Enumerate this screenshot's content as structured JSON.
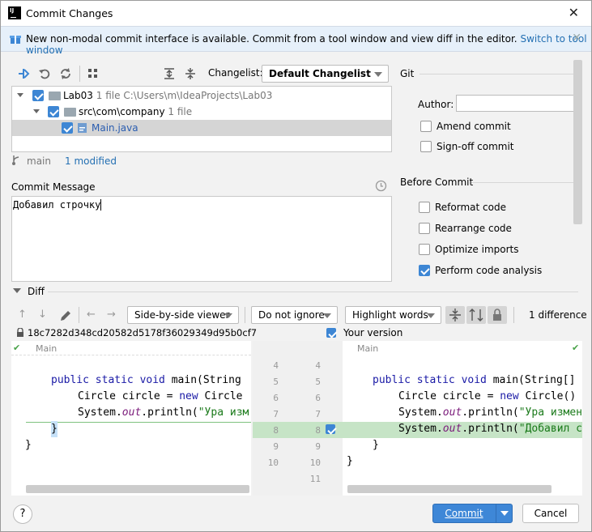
{
  "window": {
    "title": "Commit Changes",
    "close": "✕"
  },
  "banner": {
    "text": "New non-modal commit interface is available. Commit from a tool window and view diff in the editor.",
    "link": "Switch to tool window",
    "close": "✕"
  },
  "toolbar": {
    "changelist_label": "Changelist:",
    "changelist_value": "Default Changelist"
  },
  "tree": {
    "root": {
      "name": "Lab03",
      "info": "1 file",
      "path": "C:\\Users\\m\\IdeaProjects\\Lab03"
    },
    "pkg": {
      "name": "src\\com\\company",
      "info": "1 file"
    },
    "file": {
      "name": "Main.java"
    }
  },
  "status": {
    "branch": "main",
    "modified": "1 modified"
  },
  "commit_message": {
    "label": "Commit Message",
    "text": "Добавил строчку"
  },
  "git": {
    "title": "Git",
    "author_label": "Author:",
    "author_value": "",
    "amend": "Amend commit",
    "signoff": "Sign-off commit"
  },
  "before_commit": {
    "title": "Before Commit",
    "options": [
      {
        "label": "Reformat code",
        "checked": false
      },
      {
        "label": "Rearrange code",
        "checked": false
      },
      {
        "label": "Optimize imports",
        "checked": false
      },
      {
        "label": "Perform code analysis",
        "checked": true
      }
    ]
  },
  "diff": {
    "title": "Diff",
    "viewer": "Side-by-side viewer",
    "ignore": "Do not ignore",
    "highlight": "Highlight words",
    "count": "1 difference",
    "left_hash": "18c7282d348cd20582d5178f36029349d95b0cf7",
    "right_label": "Your version",
    "left_tab": "Main",
    "right_tab": "Main",
    "left_lines": [
      "public static void main(String",
      "Circle circle = new Circle",
      "System.out.println(\"Ура изм",
      "}",
      "}"
    ],
    "right_lines": [
      "public static void main(String[]",
      "Circle circle = new Circle()",
      "System.out.println(\"Ура измен",
      "System.out.println(\"Добавил с",
      "}",
      "}"
    ],
    "left_numbers": [
      "4",
      "5",
      "6",
      "7",
      "8",
      "9",
      "10"
    ],
    "right_numbers": [
      "4",
      "5",
      "6",
      "7",
      "8",
      "9",
      "10",
      "11"
    ]
  },
  "buttons": {
    "commit": "Commit",
    "cancel": "Cancel",
    "help": "?"
  }
}
